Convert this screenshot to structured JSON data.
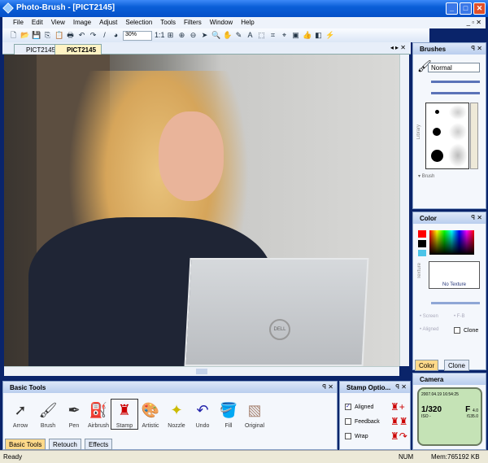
{
  "window": {
    "title": "Photo-Brush - [PICT2145]"
  },
  "menu": [
    "File",
    "Edit",
    "View",
    "Image",
    "Adjust",
    "Selection",
    "Tools",
    "Filters",
    "Window",
    "Help"
  ],
  "toolbar": {
    "zoom": "30%",
    "actual_size": "1:1"
  },
  "doc_tabs": [
    "PICT2145",
    "PICT2145"
  ],
  "brushes": {
    "title": "Brushes",
    "mode": "Normal",
    "library_label": "Library",
    "brush_label": "Brush"
  },
  "color": {
    "title": "Color",
    "texture_label": "Texture",
    "texture_value": "No Texture",
    "screen": "Screen",
    "fb": "F-B",
    "aligned": "Aligned",
    "clone": "Clone",
    "tabs": [
      "Color",
      "Clone"
    ],
    "foreground": "#ff0000",
    "background": "#000000"
  },
  "camera": {
    "title": "Camera",
    "datetime": "2007.04.19 16:54:25",
    "shutter": "1/320",
    "f_label": "F",
    "aperture": "4.0",
    "iso": "ISO -",
    "focal": "f135.0"
  },
  "basic_tools": {
    "title": "Basic Tools",
    "tools": [
      "Arrow",
      "Brush",
      "Pen",
      "Airbrush",
      "Stamp",
      "Artistic",
      "Nozzle",
      "Undo",
      "Fill",
      "Original"
    ],
    "tabs": [
      "Basic Tools",
      "Retouch",
      "Effects"
    ]
  },
  "stamp_options": {
    "title": "Stamp Optio...",
    "options": [
      {
        "label": "Aligned",
        "checked": true
      },
      {
        "label": "Feedback",
        "checked": false
      },
      {
        "label": "Wrap",
        "checked": false
      }
    ]
  },
  "status": {
    "text": "Ready",
    "num": "NUM",
    "mem": "Mem:765192 KB"
  }
}
